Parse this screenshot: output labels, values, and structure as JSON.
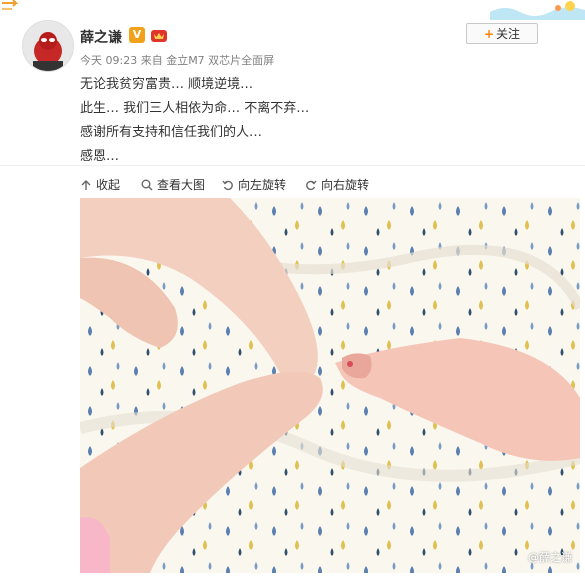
{
  "user": {
    "name": "薛之谦",
    "verified_badge": "V"
  },
  "meta": {
    "time_source": "今天 09:23 来自 金立M7 双芯片全面屏"
  },
  "follow": {
    "plus": "+",
    "label": "关注"
  },
  "post": {
    "lines": [
      "无论我贫穷富贵… 顺境逆境…",
      "此生… 我们三人相依为命… 不离不弃…",
      "感谢所有支持和信任我们的人…",
      "感恩…"
    ]
  },
  "toolbar": {
    "collapse": "收起",
    "view_large": "查看大图",
    "rotate_left": "向左旋转",
    "rotate_right": "向右旋转"
  },
  "photo": {
    "watermark": "@薛之谦"
  },
  "colors": {
    "accent": "#ff8200",
    "vip": "#e0352b",
    "verified": "#f2a11a",
    "meta_text": "#808080"
  }
}
